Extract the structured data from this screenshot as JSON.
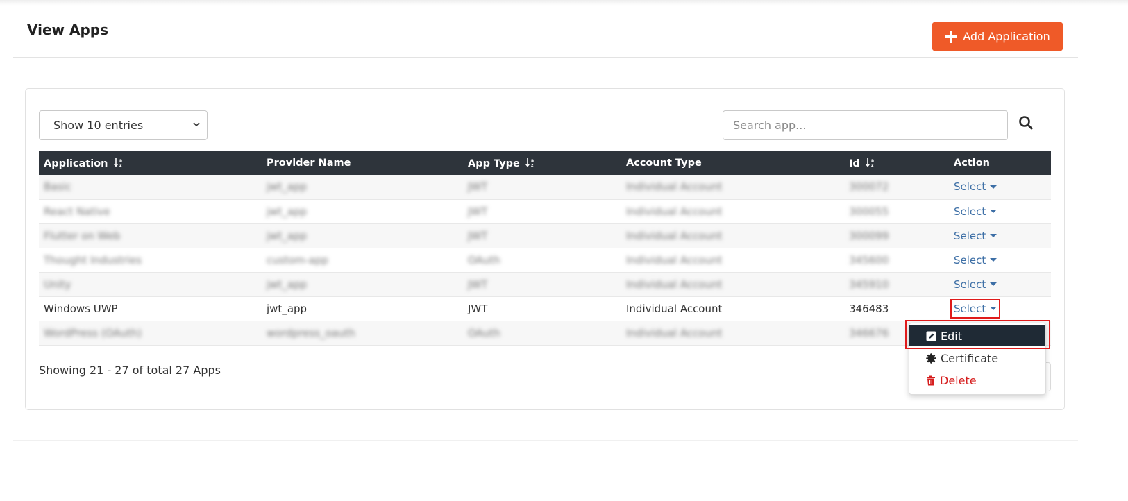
{
  "page": {
    "title": "View Apps",
    "add_button_label": "Add Application"
  },
  "controls": {
    "length_select_value": "Show 10 entries",
    "search_placeholder": "Search app..."
  },
  "table": {
    "headers": {
      "application": "Application",
      "provider": "Provider Name",
      "app_type": "App Type",
      "account_type": "Account Type",
      "id": "Id",
      "action": "Action"
    },
    "rows": [
      {
        "application": "Basic",
        "provider": "jwt_app",
        "app_type": "JWT",
        "account_type": "Individual Account",
        "id": "300072",
        "action": "Select",
        "blurred": true
      },
      {
        "application": "React Native",
        "provider": "jwt_app",
        "app_type": "JWT",
        "account_type": "Individual Account",
        "id": "300055",
        "action": "Select",
        "blurred": true
      },
      {
        "application": "Flutter on Web",
        "provider": "jwt_app",
        "app_type": "JWT",
        "account_type": "Individual Account",
        "id": "300099",
        "action": "Select",
        "blurred": true
      },
      {
        "application": "Thought Industries",
        "provider": "custom-app",
        "app_type": "OAuth",
        "account_type": "Individual Account",
        "id": "345600",
        "action": "Select",
        "blurred": true
      },
      {
        "application": "Unity",
        "provider": "jwt_app",
        "app_type": "JWT",
        "account_type": "Individual Account",
        "id": "345910",
        "action": "Select",
        "blurred": true
      },
      {
        "application": "Windows UWP",
        "provider": "jwt_app",
        "app_type": "JWT",
        "account_type": "Individual Account",
        "id": "346483",
        "action": "Select",
        "blurred": false
      },
      {
        "application": "WordPress (OAuth)",
        "provider": "wordpress_oauth",
        "app_type": "OAuth",
        "account_type": "Individual Account",
        "id": "346676",
        "action": "Select",
        "blurred": true
      }
    ]
  },
  "footer": {
    "showing_text": "Showing 21 - 27 of total 27 Apps"
  },
  "dropdown": {
    "edit_label": "Edit",
    "certificate_label": "Certificate",
    "delete_label": "Delete"
  },
  "colors": {
    "accent": "#ef5a28",
    "header_bg": "#2e343b",
    "link": "#3d6fa6",
    "danger": "#d61f1f",
    "highlight": "#e01b1b"
  },
  "icons": [
    "plus-icon",
    "chevron-down-icon",
    "search-icon",
    "sort-alpha-icon",
    "caret-down-icon",
    "edit-icon",
    "certificate-icon",
    "trash-icon"
  ]
}
